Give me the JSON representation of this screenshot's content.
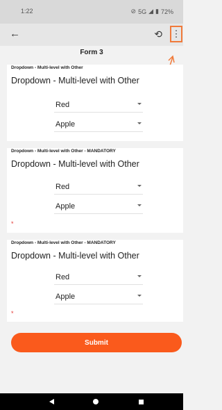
{
  "status": {
    "time": "1:22",
    "network": "5G",
    "battery": "72%"
  },
  "appbar": {
    "back_icon": "arrow-left-icon",
    "history_icon": "history-icon",
    "menu_icon": "more-vertical-icon"
  },
  "form": {
    "title": "Form 3",
    "sections": [
      {
        "small_label": "Dropdown - Multi-level with Other",
        "big_label": "Dropdown - Multi-level with Other",
        "select1": "Red",
        "select2": "Apple"
      },
      {
        "small_label": "Dropdown - Multi-level with Other - MANDATORY",
        "big_label": "Dropdown - Multi-level with Other",
        "select1": "Red",
        "select2": "Apple",
        "required_mark": "*"
      },
      {
        "small_label": "Dropdown - Multi-level with Other - MANDATORY",
        "big_label": "Dropdown - Multi-level with Other",
        "select1": "Red",
        "select2": "Apple",
        "required_mark": "*"
      }
    ],
    "submit_label": "Submit"
  },
  "colors": {
    "accent": "#fa5a1c",
    "highlight": "#f07a3a",
    "required": "#e53935"
  }
}
